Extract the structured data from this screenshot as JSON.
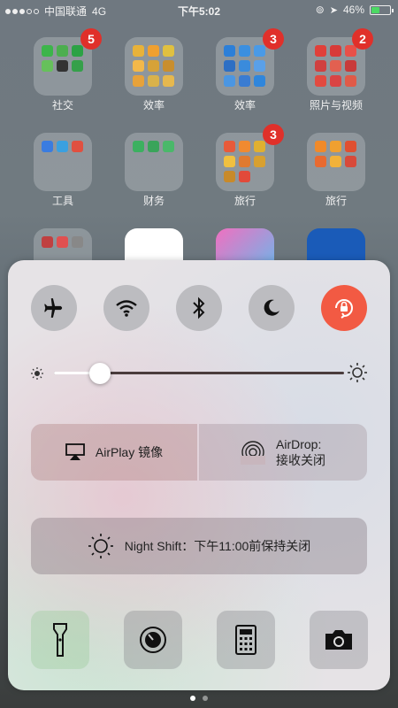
{
  "status_bar": {
    "carrier": "中国联通",
    "network": "4G",
    "time": "下午5:02",
    "battery": "46%",
    "battery_level": 0.46
  },
  "home": {
    "folders": [
      {
        "label": "社交",
        "badge": "5"
      },
      {
        "label": "效率",
        "badge": ""
      },
      {
        "label": "效率",
        "badge": "3"
      },
      {
        "label": "照片与视频",
        "badge": "2"
      },
      {
        "label": "工具",
        "badge": ""
      },
      {
        "label": "财务",
        "badge": ""
      },
      {
        "label": "旅行",
        "badge": "3"
      },
      {
        "label": "旅行",
        "badge": ""
      }
    ]
  },
  "control_center": {
    "toggles": [
      {
        "name": "airplane-mode",
        "icon": "airplane-icon",
        "active": false
      },
      {
        "name": "wifi",
        "icon": "wifi-icon",
        "active": false
      },
      {
        "name": "bluetooth",
        "icon": "bluetooth-icon",
        "active": false
      },
      {
        "name": "do-not-disturb",
        "icon": "moon-icon",
        "active": false
      },
      {
        "name": "rotation-lock",
        "icon": "rotation-lock-icon",
        "active": true
      }
    ],
    "brightness": 0.16,
    "airplay_label": "AirPlay 镜像",
    "airdrop_label_line1": "AirDrop:",
    "airdrop_label_line2": "接收关闭",
    "night_shift_label": "Night Shift：下午11:00前保持关闭",
    "tools": [
      "flashlight-icon",
      "timer-icon",
      "calculator-icon",
      "camera-icon"
    ],
    "accent_color": "#f25a43"
  },
  "page_indicator": {
    "current": 1,
    "total": 2
  }
}
